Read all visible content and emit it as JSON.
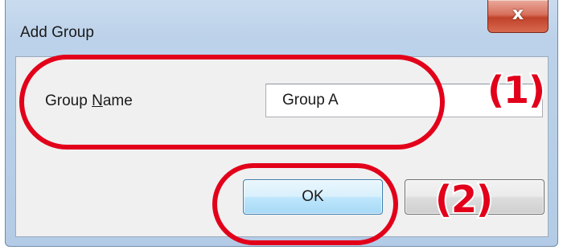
{
  "window": {
    "title": "Add Group",
    "close_glyph": "x"
  },
  "form": {
    "label_prefix": "Group ",
    "label_accel": "N",
    "label_suffix": "ame",
    "name_value": "Group A"
  },
  "buttons": {
    "ok_label": "OK",
    "cancel_label": ""
  },
  "annotations": {
    "marker_1": "(1)",
    "marker_2": "(2)",
    "ring_color": "#e2001a"
  }
}
